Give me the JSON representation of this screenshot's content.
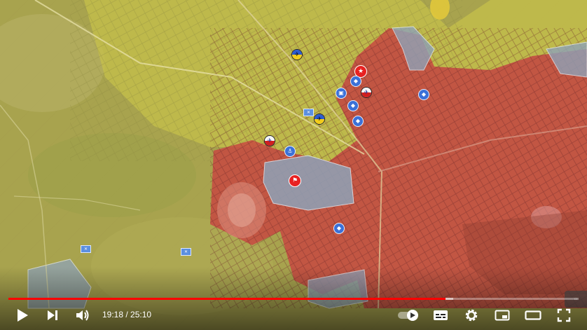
{
  "player": {
    "current_time": "19:18",
    "time_separator": " / ",
    "duration": "25:10",
    "progress": 0.767,
    "buffered": 0.78,
    "autoplay_on": false
  },
  "controls": {
    "play_icon": "play-icon",
    "next_icon": "next-icon",
    "volume_icon": "volume-icon",
    "autoplay_icon": "autoplay-toggle-icon",
    "subtitles_icon": "subtitles-icon",
    "settings_icon": "gear-icon",
    "miniplayer_icon": "miniplayer-icon",
    "theater_icon": "theater-mode-icon",
    "fullscreen_icon": "fullscreen-icon"
  },
  "colors": {
    "controlled_zone_a": "#c94040",
    "controlled_zone_b": "#b8b43a",
    "contested_zone": "#8fa3b8",
    "progress_played": "#ff0000",
    "marker_blue": "#3b71d8",
    "marker_red": "#e82121"
  }
}
